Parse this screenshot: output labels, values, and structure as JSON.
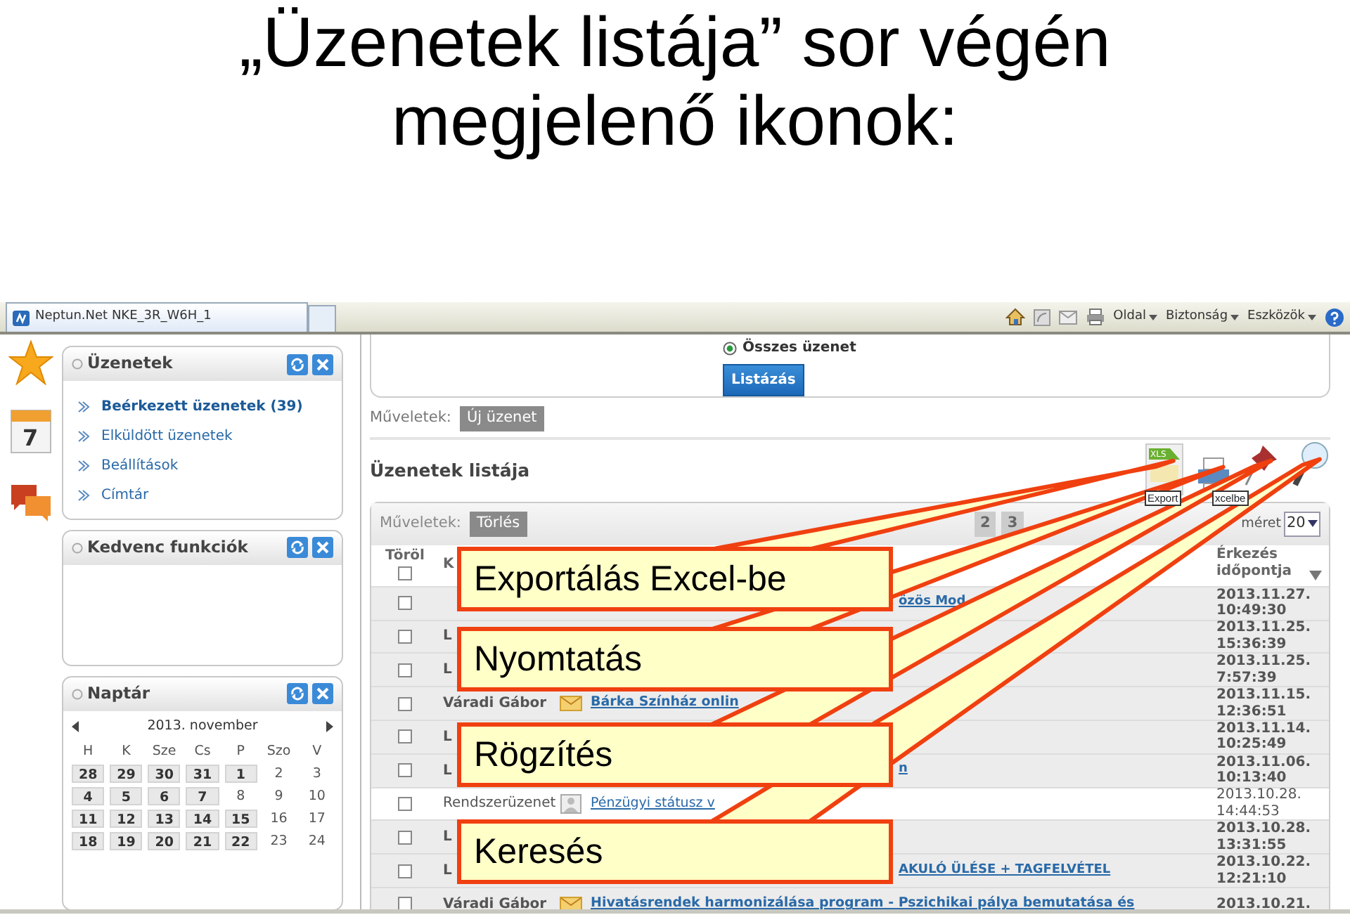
{
  "slide_title": [
    "„Üzenetek listája” sor végén",
    "megjelenő ikonok:"
  ],
  "browser": {
    "tab_title": "Neptun.Net NKE_3R_W6H_1",
    "menus": [
      "Oldal",
      "Biztonság",
      "Eszközök"
    ]
  },
  "calendar_icon_text": "7",
  "sidebar": {
    "panels": [
      {
        "kind": "menu",
        "title": "Üzenetek",
        "items": [
          {
            "label": "Beérkezett üzenetek (39)",
            "selected": true
          },
          {
            "label": "Elküldött üzenetek",
            "selected": false
          },
          {
            "label": "Beállítások",
            "selected": false
          },
          {
            "label": "Címtár",
            "selected": false
          }
        ]
      },
      {
        "kind": "empty",
        "title": "Kedvenc funkciók"
      },
      {
        "kind": "calendar",
        "title": "Naptár",
        "month": "2013. november",
        "weekdays": [
          "H",
          "K",
          "Sze",
          "Cs",
          "P",
          "Szo",
          "V"
        ],
        "weeks": [
          [
            {
              "day": "28",
              "highlighted": true
            },
            {
              "day": "29",
              "highlighted": true
            },
            {
              "day": "30",
              "highlighted": true
            },
            {
              "day": "31",
              "highlighted": true
            },
            {
              "day": "1",
              "highlighted": true
            },
            {
              "day": "2",
              "highlighted": false
            },
            {
              "day": "3",
              "highlighted": false
            }
          ],
          [
            {
              "day": "4",
              "highlighted": true
            },
            {
              "day": "5",
              "highlighted": true
            },
            {
              "day": "6",
              "highlighted": true
            },
            {
              "day": "7",
              "highlighted": true
            },
            {
              "day": "8",
              "highlighted": false
            },
            {
              "day": "9",
              "highlighted": false
            },
            {
              "day": "10",
              "highlighted": false
            }
          ],
          [
            {
              "day": "11",
              "highlighted": true
            },
            {
              "day": "12",
              "highlighted": true
            },
            {
              "day": "13",
              "highlighted": true
            },
            {
              "day": "14",
              "highlighted": true
            },
            {
              "day": "15",
              "highlighted": true
            },
            {
              "day": "16",
              "highlighted": false
            },
            {
              "day": "17",
              "highlighted": false
            }
          ],
          [
            {
              "day": "18",
              "highlighted": true
            },
            {
              "day": "19",
              "highlighted": true
            },
            {
              "day": "20",
              "highlighted": true
            },
            {
              "day": "21",
              "highlighted": true
            },
            {
              "day": "22",
              "highlighted": true
            },
            {
              "day": "23",
              "highlighted": false
            },
            {
              "day": "24",
              "highlighted": false
            }
          ]
        ]
      }
    ]
  },
  "filter": {
    "radio": {
      "label": "Összes üzenet",
      "selected": true
    },
    "button": "Listázás"
  },
  "actions": {
    "label": "Műveletek:",
    "button": "Új üzenet"
  },
  "list": {
    "title": "Üzenetek listája",
    "xls_label": "XLS",
    "tooltip_parts": [
      "Export",
      "xcelbe"
    ],
    "toolbar_label": "Műveletek:",
    "delete_button": "Törlés",
    "pages": [
      "2",
      "3"
    ],
    "page_size_label": "méret",
    "page_size": "20",
    "columns": [
      "Töröl",
      "K",
      "Érkezés időpontja"
    ],
    "select_all_checked": false,
    "rows": [
      {
        "unread": true,
        "checked": false,
        "subject_tail": "özös Mod",
        "date": "2013.11.27.",
        "time": "10:49:30"
      },
      {
        "unread": true,
        "checked": false,
        "sender": "L",
        "date": "2013.11.25.",
        "time": "15:36:39"
      },
      {
        "unread": true,
        "checked": false,
        "sender": "L",
        "date": "2013.11.25.",
        "time": "7:57:39"
      },
      {
        "unread": true,
        "checked": false,
        "sender": "Váradi Gábor",
        "kind": "mail",
        "subject": "Bárka Színház onlin",
        "date": "2013.11.15.",
        "time": "12:36:51"
      },
      {
        "unread": true,
        "checked": false,
        "sender": "L",
        "date": "2013.11.14.",
        "time": "10:25:49"
      },
      {
        "unread": true,
        "checked": false,
        "sender": "L",
        "subject_tail": "n",
        "date": "2013.11.06.",
        "time": "10:13:40"
      },
      {
        "unread": false,
        "checked": false,
        "sender": "Rendszerüzenet",
        "kind": "system",
        "subject": "Pénzügyi státusz v",
        "date": "2013.10.28.",
        "time": "14:44:53"
      },
      {
        "unread": true,
        "checked": false,
        "sender": "L",
        "date": "2013.10.28.",
        "time": "13:31:55"
      },
      {
        "unread": true,
        "checked": false,
        "sender": "L",
        "subject_tail": "AKULÓ ÜLÉSE + TAGFELVÉTEL",
        "date": "2013.10.22.",
        "time": "12:21:10"
      },
      {
        "unread": true,
        "checked": false,
        "sender": "Váradi Gábor",
        "kind": "mail",
        "subject": "Hivatásrendek harmonizálása program - Pszichikai pálya bemutatása és",
        "date": "2013.10.21."
      }
    ]
  },
  "callouts": [
    "Exportálás Excel-be",
    "Nyomtatás",
    "Rögzítés",
    "Keresés"
  ]
}
